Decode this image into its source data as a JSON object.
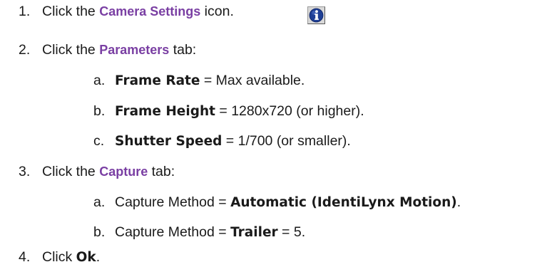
{
  "steps": [
    {
      "num": "1.",
      "parts": [
        {
          "text": "Click the ",
          "style": "plain"
        },
        {
          "text": "Camera Settings",
          "style": "ui"
        },
        {
          "text": " icon.",
          "style": "plain"
        }
      ],
      "icon": "info-icon"
    },
    {
      "num": "2.",
      "parts": [
        {
          "text": "Click the ",
          "style": "plain"
        },
        {
          "text": "Parameters",
          "style": "ui"
        },
        {
          "text": " tab:",
          "style": "plain"
        }
      ],
      "substeps": [
        {
          "letter": "a.",
          "parts": [
            {
              "text": "Frame Rate",
              "style": "bold"
            },
            {
              "text": " = Max available.",
              "style": "plain"
            }
          ]
        },
        {
          "letter": "b.",
          "parts": [
            {
              "text": "Frame Height",
              "style": "bold"
            },
            {
              "text": " = 1280x720 (or higher).",
              "style": "plain"
            }
          ]
        },
        {
          "letter": "c.",
          "parts": [
            {
              "text": "Shutter Speed",
              "style": "bold"
            },
            {
              "text": " = 1/700 (or smaller).",
              "style": "plain"
            }
          ]
        }
      ]
    },
    {
      "num": "3.",
      "parts": [
        {
          "text": "Click the ",
          "style": "plain"
        },
        {
          "text": "Capture",
          "style": "ui"
        },
        {
          "text": " tab:",
          "style": "plain"
        }
      ],
      "substeps": [
        {
          "letter": "a.",
          "parts": [
            {
              "text": "Capture Method = ",
              "style": "plain"
            },
            {
              "text": "Automatic (IdentiLynx Motion)",
              "style": "bold"
            },
            {
              "text": ".",
              "style": "plain"
            }
          ]
        },
        {
          "letter": "b.",
          "parts": [
            {
              "text": "Capture Method = ",
              "style": "plain"
            },
            {
              "text": "Trailer",
              "style": "bold"
            },
            {
              "text": " = 5.",
              "style": "plain"
            }
          ]
        }
      ]
    },
    {
      "num": "4.",
      "parts": [
        {
          "text": "Click ",
          "style": "plain"
        },
        {
          "text": "Ok",
          "style": "bold"
        },
        {
          "text": ".",
          "style": "plain"
        }
      ]
    }
  ],
  "colors": {
    "ui_label": "#7a3fa3",
    "text": "#1a1a1a",
    "icon_blue": "#1f3f95"
  }
}
